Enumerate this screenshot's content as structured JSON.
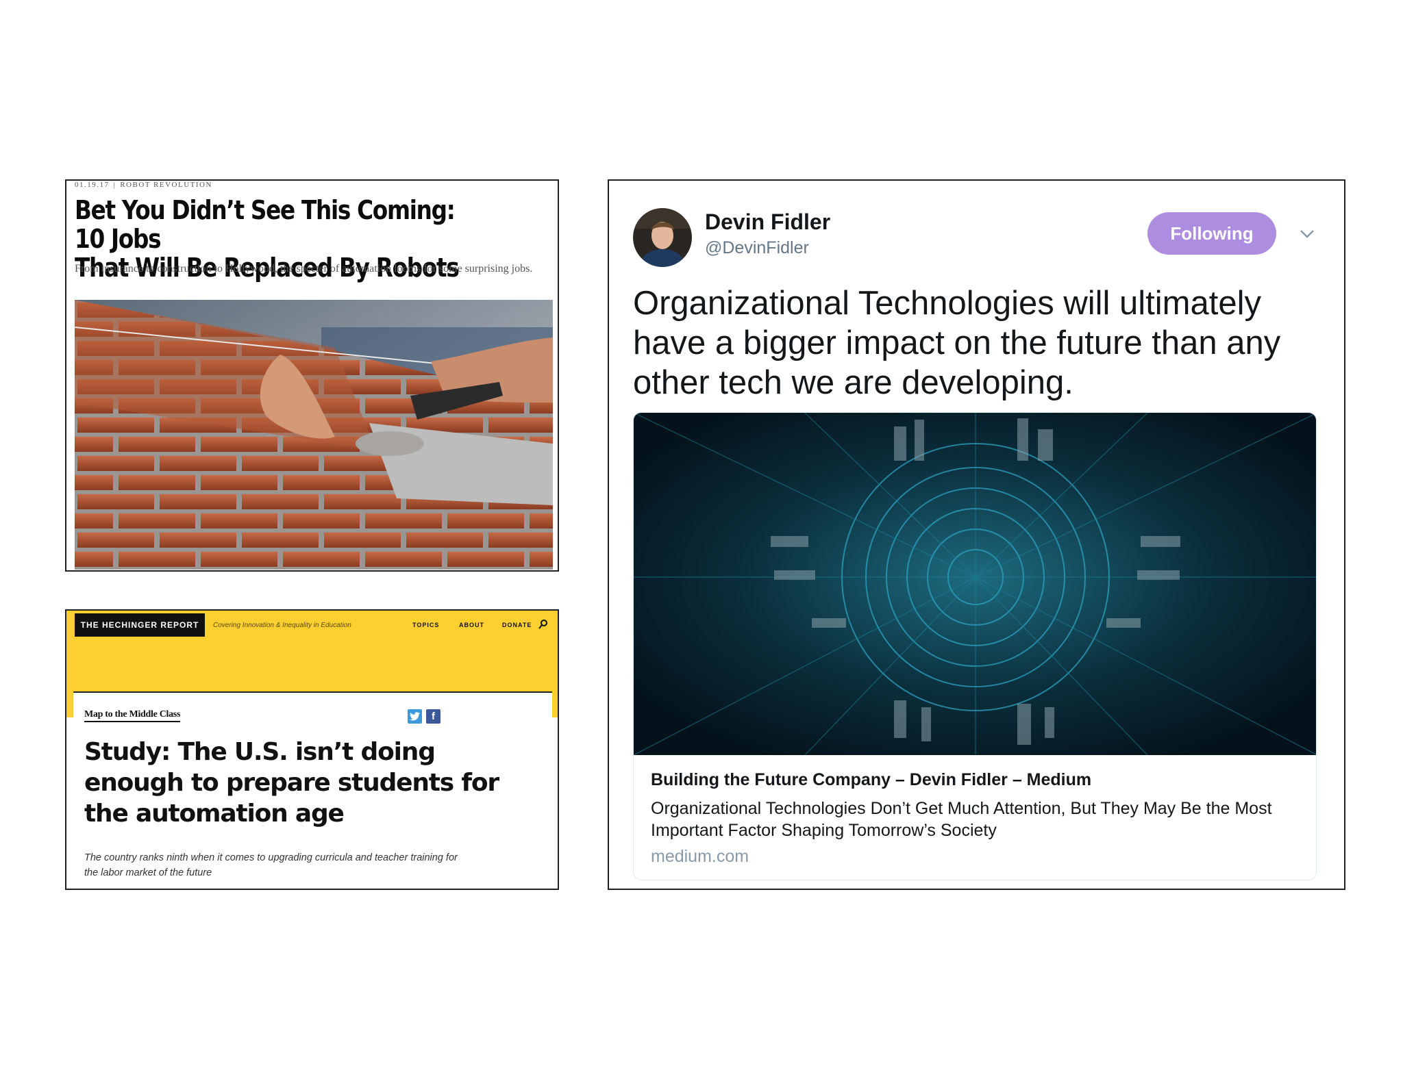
{
  "article_robots": {
    "date": "01.19.17",
    "category": "ROBOT REVOLUTION",
    "headline_line1": "Bet You Didn’t See This Coming: 10 Jobs",
    "headline_line2": "That Will Be Replaced By Robots",
    "dek": "From insurance to construction to Hollywood, the specter of automation looms for some surprising jobs."
  },
  "hechinger": {
    "logo": "THE HECHINGER REPORT",
    "tagline": "Covering Innovation & Inequality in Education",
    "nav": {
      "topics": "TOPICS",
      "about": "ABOUT",
      "donate": "DONATE"
    },
    "section": "Map to the Middle Class",
    "facebook_glyph": "f",
    "headline": "Study: The U.S. isn’t doing enough to prepare students for the automation age",
    "dek": "The country ranks ninth when it comes to upgrading curricula and teacher training for the labor market of the future"
  },
  "tweet": {
    "name": "Devin Fidler",
    "handle": "@DevinFidler",
    "follow_label": "Following",
    "text": "Organizational Technologies will ultimately have a bigger impact on the future than any other tech we are developing.",
    "card": {
      "title": "Building the Future Company – Devin Fidler – Medium",
      "description": "Organizational Technologies Don’t Get Much Attention, But They May Be the Most Important Factor Shaping Tomorrow’s Society",
      "domain": "medium.com"
    }
  },
  "colors": {
    "hechinger_yellow": "#fdcf30",
    "follow_purple": "#ad8de0",
    "twitter_blue": "#3c99dc",
    "facebook_blue": "#3b5998"
  },
  "icons": [
    "search-icon",
    "twitter-icon",
    "facebook-icon",
    "chevron-down-icon"
  ]
}
